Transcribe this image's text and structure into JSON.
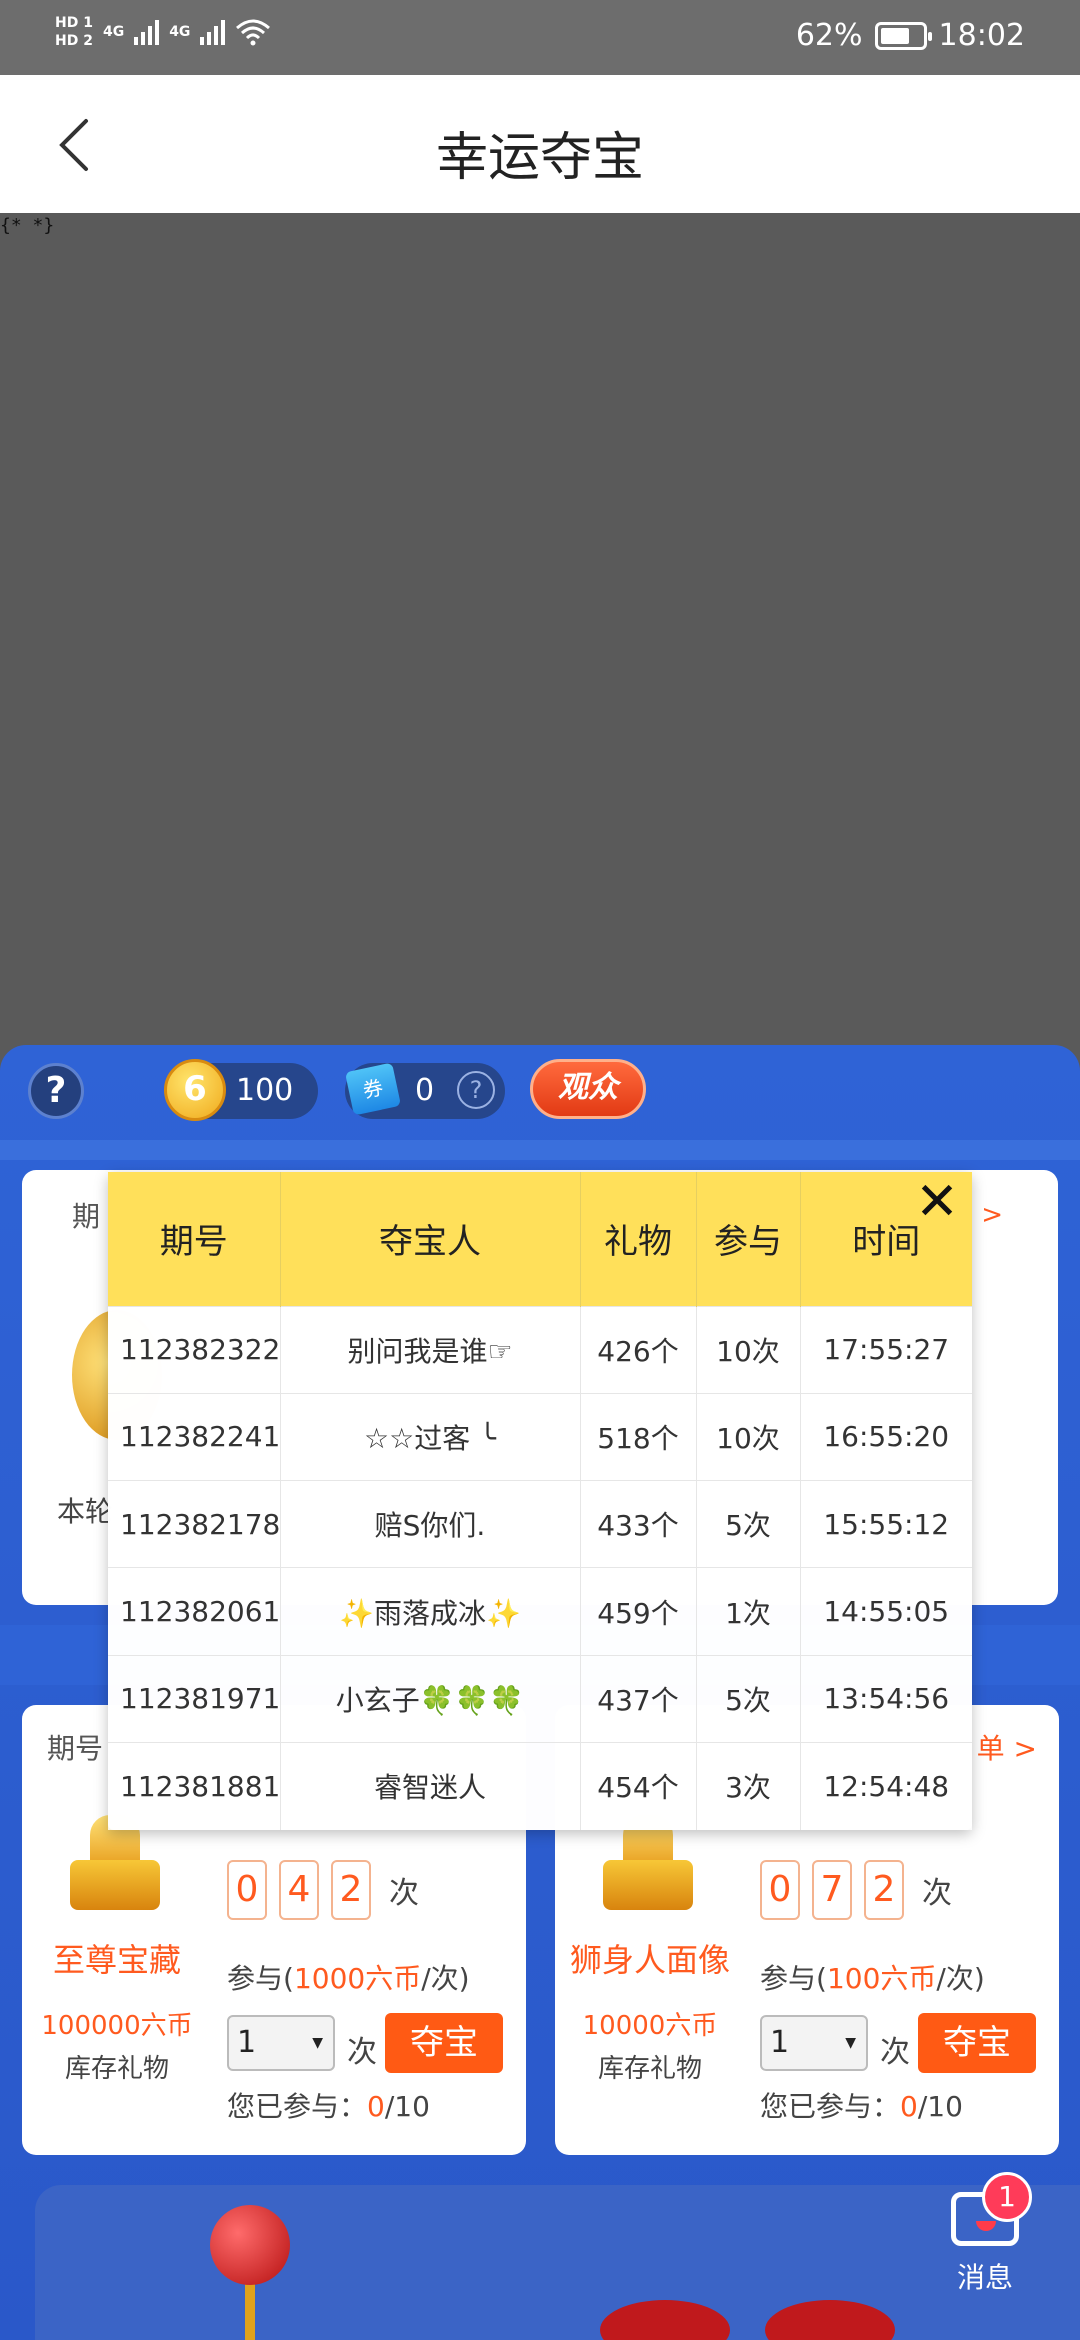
{
  "status_bar": {
    "hd1": "HD 1",
    "hd2": "HD 2",
    "net1": "4G",
    "net2": "4G",
    "battery": "62%",
    "time": "18:02"
  },
  "header": {
    "title": "幸运夺宝"
  },
  "debug_text": "{* *}",
  "game": {
    "help": "?",
    "coins": "100",
    "coin_symbol": "6",
    "tickets": "0",
    "ticket_symbol": "券",
    "ticket_help": "?",
    "audience_label": "观众"
  },
  "top_panel": {
    "period_prefix": "期",
    "link_tail": "l >",
    "round_prefix": "本轮"
  },
  "cards": [
    {
      "period_label": "期号",
      "rank_link": "",
      "gift_name": "至尊宝藏",
      "price": "100000六币",
      "stock": "库存礼物",
      "digits": [
        "0",
        "4",
        "2"
      ],
      "digits_unit": "次",
      "participate_prefix": "参与(",
      "participate_amount": "1000六币",
      "participate_suffix": "/次)",
      "qty": "1",
      "times": "次",
      "grab": "夺宝",
      "joined_label": "您已参与：",
      "joined_count": "0",
      "joined_total": "/10"
    },
    {
      "period_label": "",
      "rank_link": "单 >",
      "gift_name": "狮身人面像",
      "price": "10000六币",
      "stock": "库存礼物",
      "digits": [
        "0",
        "7",
        "2"
      ],
      "digits_unit": "次",
      "participate_prefix": "参与(",
      "participate_amount": "100六币",
      "participate_suffix": "/次)",
      "qty": "1",
      "times": "次",
      "grab": "夺宝",
      "joined_label": "您已参与：",
      "joined_count": "0",
      "joined_total": "/10"
    }
  ],
  "messages": {
    "label": "消息",
    "badge": "1"
  },
  "history": {
    "columns": [
      "期号",
      "夺宝人",
      "礼物",
      "参与",
      "时间"
    ],
    "rows": [
      [
        "112382322",
        "别问我是谁☞",
        "426个",
        "10次",
        "17:55:27"
      ],
      [
        "112382241",
        "☆☆过客 ╰",
        "518个",
        "10次",
        "16:55:20"
      ],
      [
        "112382178",
        "赔S你们.",
        "433个",
        "5次",
        "15:55:12"
      ],
      [
        "112382061",
        "✨雨落成冰✨",
        "459个",
        "1次",
        "14:55:05"
      ],
      [
        "112381971",
        "小玄子🍀🍀🍀",
        "437个",
        "5次",
        "13:54:56"
      ],
      [
        "112381881",
        "睿智迷人",
        "454个",
        "3次",
        "12:54:48"
      ]
    ],
    "close": "✕"
  }
}
